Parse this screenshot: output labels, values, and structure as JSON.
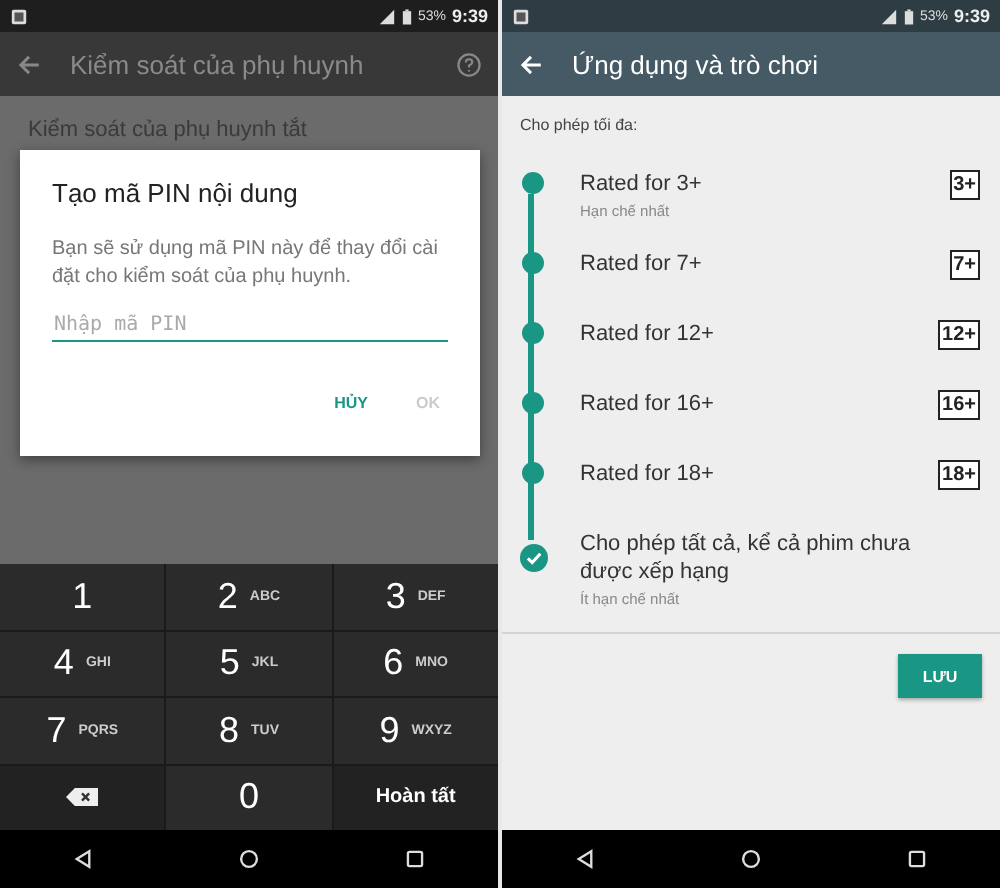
{
  "left_screen": {
    "status_bar": {
      "battery": "53%",
      "time": "9:39"
    },
    "app_bar": {
      "title": "Kiểm soát của phụ huynh"
    },
    "setting_row": "Kiểm soát của phụ huynh tắt",
    "dialog": {
      "title": "Tạo mã PIN nội dung",
      "message": "Bạn sẽ sử dụng mã PIN này để thay đổi cài đặt cho kiểm soát của phụ huynh.",
      "pin_field": {
        "placeholder": "Nhập mã PIN"
      },
      "buttons": [
        {
          "label": "HỦY",
          "disabled": false
        },
        {
          "label": "OK",
          "disabled": true
        }
      ]
    },
    "keypad": [
      {
        "kind": "digit",
        "label": "1"
      },
      {
        "kind": "digit",
        "label": "2",
        "letters": "ABC"
      },
      {
        "kind": "digit",
        "label": "3",
        "letters": "DEF"
      },
      {
        "kind": "digit",
        "label": "4",
        "letters": "GHI"
      },
      {
        "kind": "digit",
        "label": "5",
        "letters": "JKL"
      },
      {
        "kind": "digit",
        "label": "6",
        "letters": "MNO"
      },
      {
        "kind": "digit",
        "label": "7",
        "letters": "PQRS"
      },
      {
        "kind": "digit",
        "label": "8",
        "letters": "TUV"
      },
      {
        "kind": "digit",
        "label": "9",
        "letters": "WXYZ"
      },
      {
        "kind": "backspace"
      },
      {
        "kind": "digit",
        "label": "0"
      },
      {
        "kind": "done",
        "label": "Hoàn tất"
      }
    ]
  },
  "right_screen": {
    "status_bar": {
      "battery": "53%",
      "time": "9:39"
    },
    "app_bar": {
      "title": "Ứng dụng và trò chơi"
    },
    "section_label": "Cho phép tối đa:",
    "ratings": [
      {
        "label": "Rated for 3+",
        "sublabel": "Hạn chế nhất",
        "badge": "3+",
        "selected": false
      },
      {
        "label": "Rated for 7+",
        "badge": "7+",
        "selected": false
      },
      {
        "label": "Rated for 12+",
        "badge": "12+",
        "selected": false
      },
      {
        "label": "Rated for 16+",
        "badge": "16+",
        "selected": false
      },
      {
        "label": "Rated for 18+",
        "badge": "18+",
        "selected": false
      },
      {
        "label": "Cho phép tất cả, kể cả phim chưa được xếp hạng",
        "sublabel": "Ít hạn chế nhất",
        "selected": true
      }
    ],
    "save_button": "LƯU"
  }
}
